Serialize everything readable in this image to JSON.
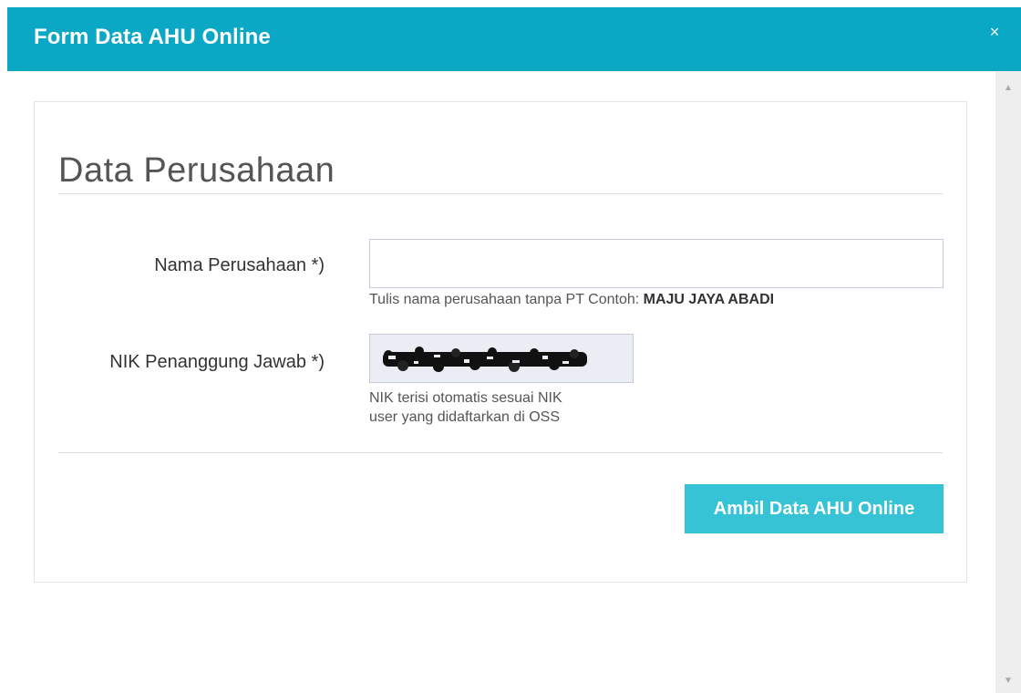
{
  "modal": {
    "title": "Form Data AHU Online",
    "close_icon": "×"
  },
  "section": {
    "title": "Data Perusahaan"
  },
  "fields": {
    "nama": {
      "label": "Nama Perusahaan *)",
      "value": "",
      "help_prefix": "Tulis nama perusahaan tanpa PT Contoh: ",
      "help_example": "MAJU JAYA ABADI"
    },
    "nik": {
      "label": "NIK Penanggung Jawab *)",
      "help_line_1": "NIK terisi otomatis sesuai NIK",
      "help_line_2": "user yang didaftarkan di OSS",
      "redacted": true
    }
  },
  "actions": {
    "submit_label": "Ambil Data AHU Online"
  },
  "scrollbar": {
    "up_arrow": "▲",
    "down_arrow": "▼"
  },
  "colors": {
    "header": "#0aa8c4",
    "button": "#36c3d6",
    "input_disabled": "#eaeef4"
  }
}
